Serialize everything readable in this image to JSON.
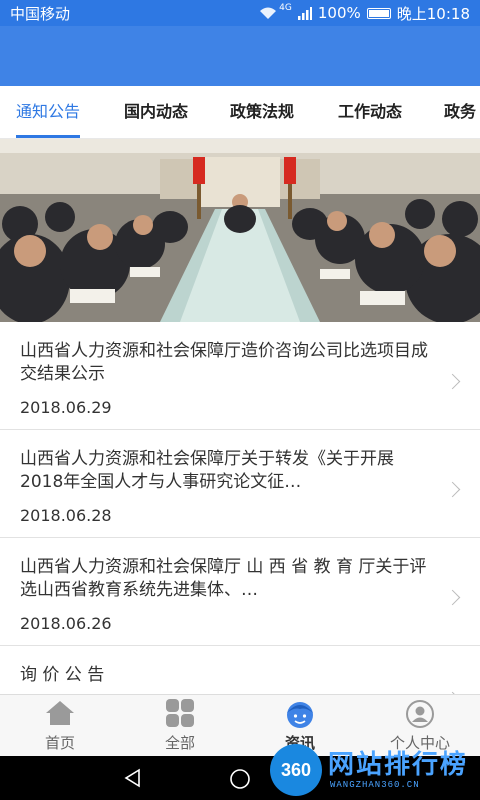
{
  "status": {
    "carrier": "中国移动",
    "network": "4G",
    "battery": "100%",
    "time": "晚上10:18"
  },
  "tabs": [
    {
      "label": "通知公告",
      "active": true
    },
    {
      "label": "国内动态"
    },
    {
      "label": "政策法规"
    },
    {
      "label": "工作动态"
    },
    {
      "label": "政务"
    }
  ],
  "banner": {
    "slides": 3,
    "current": 1
  },
  "articles": [
    {
      "title": "山西省人力资源和社会保障厅造价咨询公司比选项目成交结果公示",
      "date": "2018.06.29"
    },
    {
      "title": "山西省人力资源和社会保障厅关于转发《关于开展2018年全国人才与人事研究论文征…",
      "date": "2018.06.28"
    },
    {
      "title": "山西省人力资源和社会保障厅 山 西 省 教 育 厅关于评选山西省教育系统先进集体、…",
      "date": "2018.06.26"
    },
    {
      "title": "询 价 公 告",
      "date": ""
    }
  ],
  "bottom_nav": [
    {
      "label": "首页",
      "icon": "home-icon"
    },
    {
      "label": "全部",
      "icon": "grid-icon"
    },
    {
      "label": "资讯",
      "icon": "news-face-icon",
      "active": true
    },
    {
      "label": "个人中心",
      "icon": "person-icon"
    }
  ],
  "watermark": {
    "badge": "360",
    "name": "网站排行榜",
    "site": "WANGZHAN360.CN"
  },
  "colors": {
    "primary": "#3f83e6",
    "active_tab": "#2e78e3"
  }
}
